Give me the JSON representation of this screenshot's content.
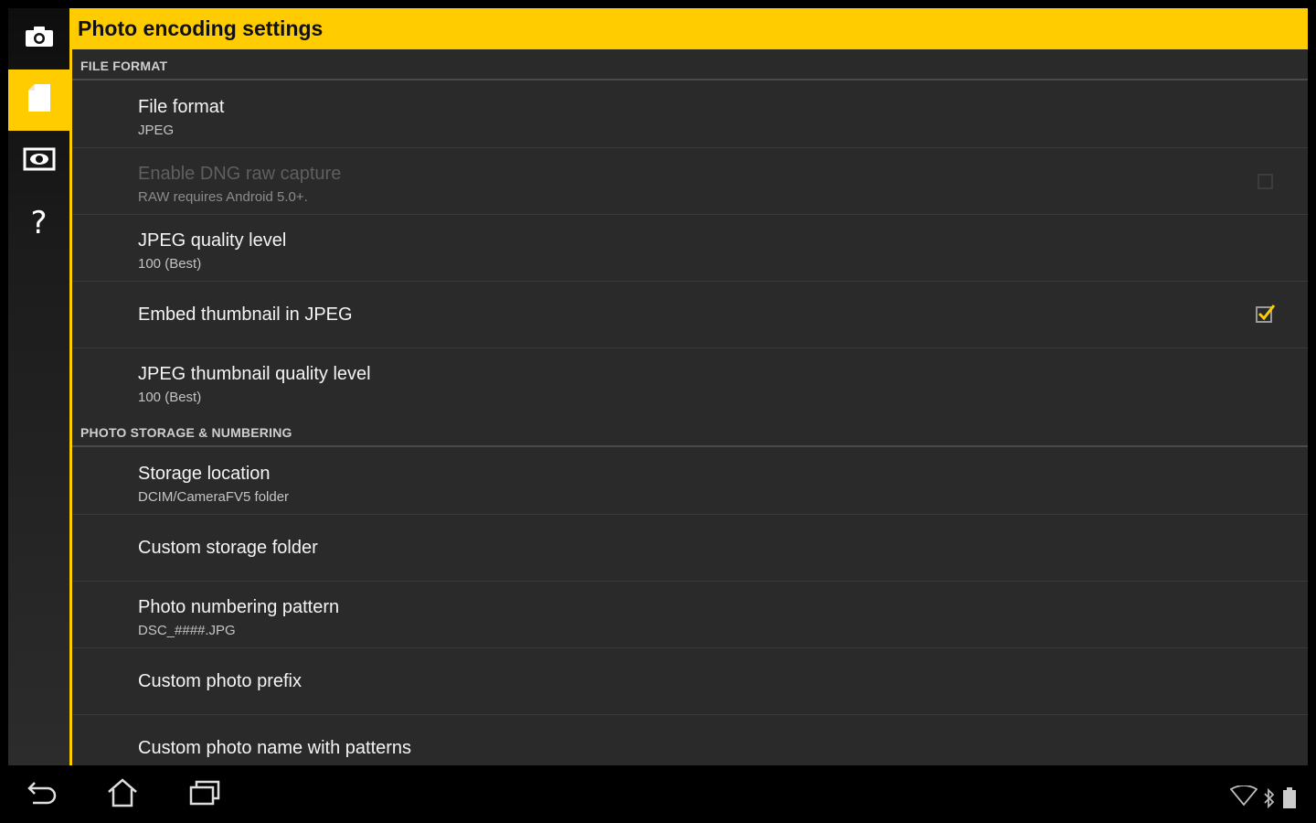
{
  "rail": {
    "items": [
      {
        "icon": "camera-icon"
      },
      {
        "icon": "file-icon"
      },
      {
        "icon": "eye-icon"
      },
      {
        "icon": "help-icon",
        "glyph": "?"
      }
    ],
    "accent": "#ffcc00"
  },
  "header": {
    "title": "Photo encoding settings"
  },
  "sections": {
    "file_format": {
      "label": "FILE FORMAT"
    },
    "storage": {
      "label": "PHOTO STORAGE & NUMBERING"
    }
  },
  "settings": {
    "file_format": {
      "title": "File format",
      "summary": "JPEG"
    },
    "dng": {
      "title": "Enable DNG raw capture",
      "summary": "RAW requires Android 5.0+.",
      "enabled": false,
      "checked": false
    },
    "jpeg_quality": {
      "title": "JPEG quality level",
      "summary": "100 (Best)"
    },
    "embed_thumb": {
      "title": "Embed thumbnail in JPEG",
      "checked": true
    },
    "thumb_quality": {
      "title": "JPEG thumbnail quality level",
      "summary": "100 (Best)"
    },
    "storage_location": {
      "title": "Storage location",
      "summary": "DCIM/CameraFV5 folder"
    },
    "custom_folder": {
      "title": "Custom storage folder"
    },
    "numbering_pattern": {
      "title": "Photo numbering pattern",
      "summary": "DSC_####.JPG"
    },
    "custom_prefix": {
      "title": "Custom photo prefix"
    },
    "custom_name": {
      "title": "Custom photo name with patterns"
    }
  },
  "navbar": {
    "buttons": [
      "back-icon",
      "home-icon",
      "recent-apps-icon"
    ],
    "status": [
      "wifi-icon",
      "bluetooth-icon",
      "battery-icon"
    ]
  }
}
